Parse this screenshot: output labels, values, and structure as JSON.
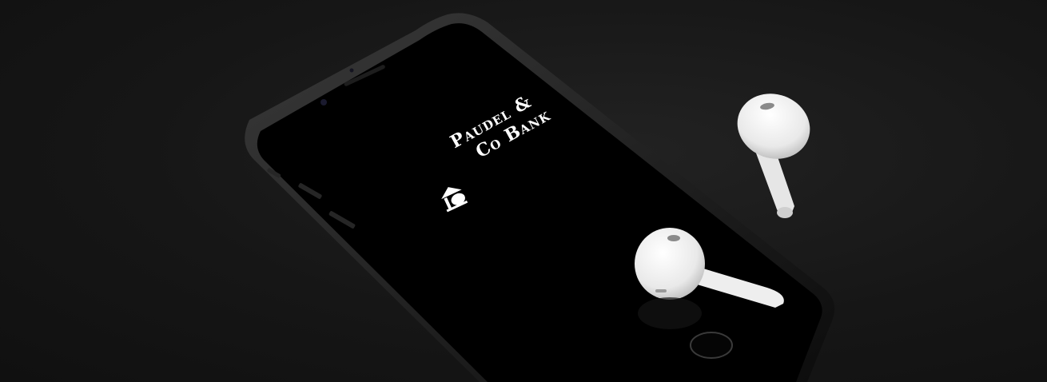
{
  "brand": {
    "line1": "Paudel &",
    "line2": "Co Bank"
  },
  "colors": {
    "background": "#171717",
    "phone_body": "#0a0a0a",
    "screen": "#000000",
    "logo": "#ffffff",
    "earbuds": "#f2f2f2"
  },
  "icons": [
    "house-piggy-bank-logo-icon"
  ]
}
